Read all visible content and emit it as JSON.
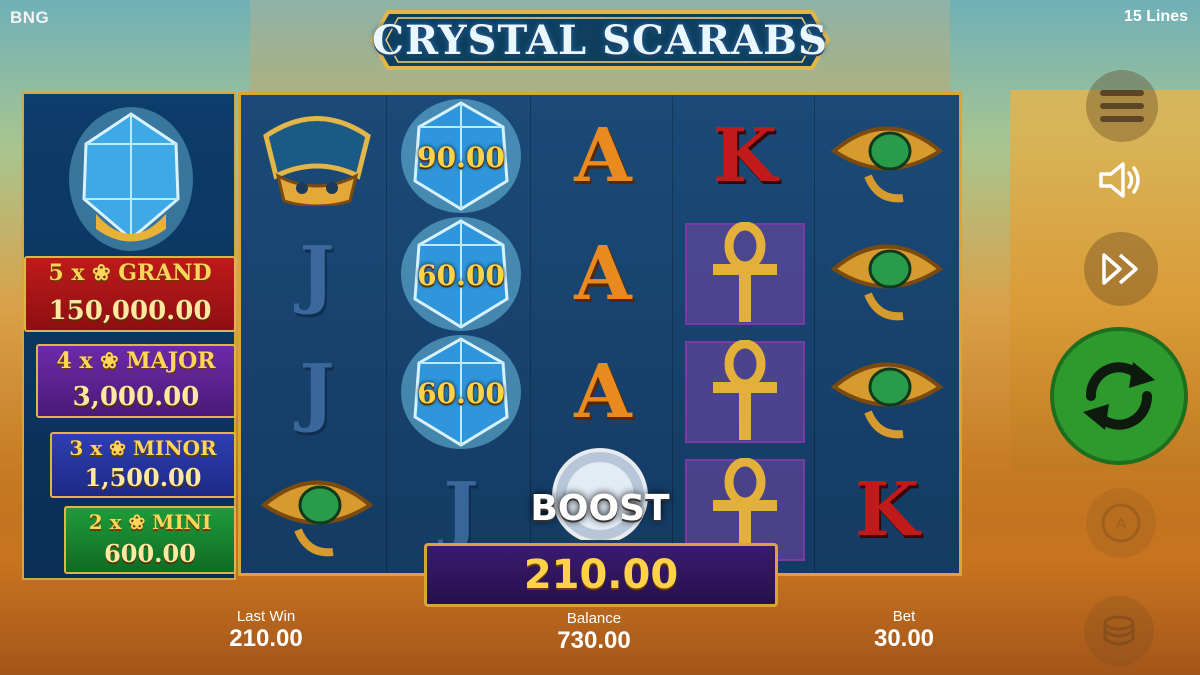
{
  "header": {
    "brand": "BNG",
    "lines": "15 Lines",
    "title": "CRYSTAL SCARABS"
  },
  "jackpots": [
    {
      "label": "5 x ❀ GRAND",
      "value": "150,000.00"
    },
    {
      "label": "4 x ❀ MAJOR",
      "value": "3,000.00"
    },
    {
      "label": "3 x ❀ MINOR",
      "value": "1,500.00"
    },
    {
      "label": "2 x ❀ MINI",
      "value": "600.00"
    }
  ],
  "reels": {
    "col1": [
      "crown-symbol",
      "J",
      "J",
      "eye-symbol"
    ],
    "col2": [
      {
        "symbol": "scarab",
        "value": "90.00"
      },
      {
        "symbol": "scarab",
        "value": "60.00"
      },
      {
        "symbol": "scarab",
        "value": "60.00"
      },
      "J"
    ],
    "col3": [
      "A",
      "A",
      "A",
      "boost-orb"
    ],
    "col4": [
      "K",
      "ankh-symbol",
      "ankh-symbol",
      "ankh-symbol"
    ],
    "col5": [
      "eye-symbol",
      "eye-symbol",
      "eye-symbol",
      "K"
    ]
  },
  "boost": {
    "label": "BOOST"
  },
  "win": {
    "value": "210.00"
  },
  "stats": {
    "last_win_label": "Last Win",
    "last_win_value": "210.00",
    "balance_label": "Balance",
    "balance_value": "730.00",
    "bet_label": "Bet",
    "bet_value": "30.00"
  },
  "controls": {
    "menu_icon": "menu-icon",
    "sound_icon": "speaker-icon",
    "turbo_icon": "fast-forward-icon",
    "spin_icon": "refresh-icon",
    "auto_icon": "autoplay-icon",
    "coins_icon": "coins-icon"
  },
  "colors": {
    "gold": "#d8a53a",
    "spin_green": "#2e9a2e",
    "grand_red": "#c01a1a",
    "major_purple": "#6d2aa8",
    "minor_blue": "#2e3fb3",
    "mini_green": "#1e9b3a"
  }
}
